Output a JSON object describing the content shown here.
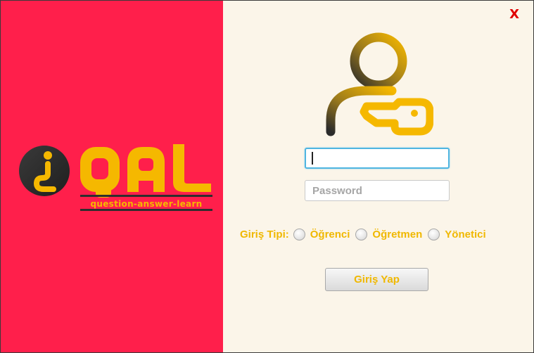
{
  "close_label": "X",
  "logo": {
    "text": "QAL",
    "tagline": "question-answer-learn"
  },
  "login": {
    "username_value": "",
    "password_placeholder": "Password",
    "type_label": "Giriş Tipi:",
    "options": [
      "Öğrenci",
      "Öğretmen",
      "Yönetici"
    ],
    "button_label": "Giriş Yap"
  },
  "colors": {
    "left_panel": "#ff1f4b",
    "right_panel": "#fbf5e9",
    "accent_yellow": "#f0b800",
    "close_red": "#e00000",
    "logo_dark": "#2e2e2e"
  },
  "icons": {
    "close": "close-icon",
    "user_key": "user-key-icon",
    "logo_mark": "inverted-question-mark-icon"
  }
}
